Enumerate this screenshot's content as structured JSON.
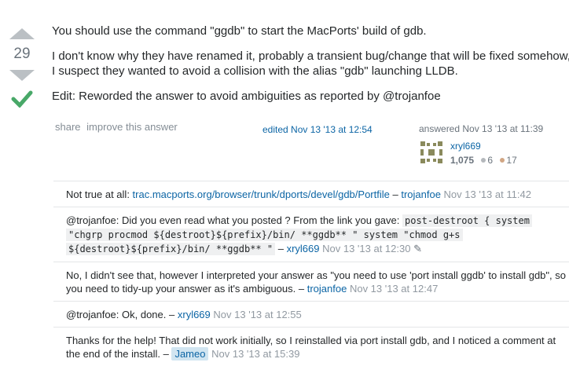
{
  "vote": {
    "count": "29"
  },
  "post": {
    "p1": "You should use the command \"ggdb\" to start the MacPorts' build of gdb.",
    "p2a": "I don't know why they have renamed it, probably a transient bug/change that will be fixed somehow,",
    "p2b": "I suspect they wanted to avoid a collision with the alias \"gdb\" launching LLDB.",
    "p3": "Edit: Reworded the answer to avoid ambiguities as reported by @trojanfoe"
  },
  "menu": {
    "share": "share",
    "improve": "improve this answer"
  },
  "edited": "edited Nov 13 '13 at 12:54",
  "answered": "answered Nov 13 '13 at 11:39",
  "user": {
    "name": "xryl669",
    "rep": "1,075",
    "silver": "6",
    "bronze": "17",
    "silver_color": "#b4b8bc",
    "bronze_color": "#d1a684"
  },
  "comments": [
    {
      "pre": "Not true at all: ",
      "link": "trac.macports.org/browser/trunk/dports/devel/gdb/Portfile",
      "dash": " – ",
      "user": "trojanfoe",
      "date": "Nov 13 '13 at 11:42"
    },
    {
      "t1": "@trojanfoe: Did you even read what you posted ? From the link you gave: ",
      "c1": "post-destroot { system",
      "c2": "\"chgrp procmod ${destroot}${prefix}/bin/ **ggdb** \" system \"chmod g+s",
      "c3": "${destroot}${prefix}/bin/ **ggdb** \"",
      "dash": " – ",
      "user": "xryl669",
      "date": "Nov 13 '13 at 12:30",
      "edit_icon": "pencil-icon"
    },
    {
      "t1": "No, I didn't see that, however I interpreted your answer as \"you need to use 'port install ggdb' to install gdb\", so",
      "t2": "you need to tidy-up your answer as it's ambiguous.",
      "dash": " – ",
      "user": "trojanfoe",
      "date": "Nov 13 '13 at 12:47"
    },
    {
      "t1": "@trojanfoe: Ok, done.",
      "dash": " – ",
      "user": "xryl669",
      "date": "Nov 13 '13 at 12:55"
    },
    {
      "t1": "Thanks for the help! That did not work initially, so I reinstalled via port install gdb, and I noticed a comment at",
      "t2": "the end of the install.",
      "dash": " – ",
      "user": "Jameo",
      "date": "Nov 13 '13 at 15:39"
    }
  ],
  "colors": {
    "link": "#0c65a5",
    "accepted": "#48a868",
    "vote_arrow": "#bbc0c4"
  }
}
